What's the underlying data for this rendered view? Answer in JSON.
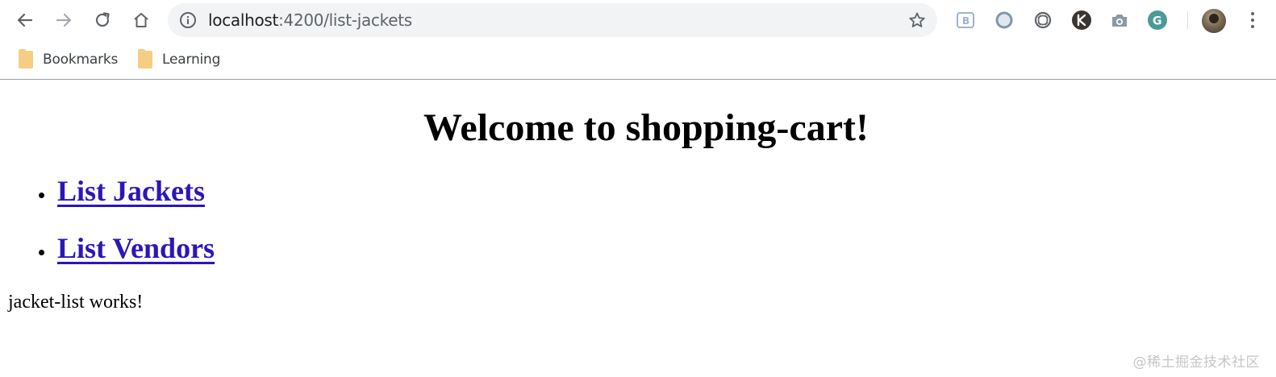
{
  "browser": {
    "url_host": "localhost",
    "url_path": ":4200/list-jackets",
    "extensions": [
      {
        "name": "bootstrap-extension-icon",
        "color": "#8fb6d8"
      },
      {
        "name": "round-extension-icon",
        "color": "#7e99a8"
      },
      {
        "name": "swirl-extension-icon",
        "color": "#5f6368"
      },
      {
        "name": "k-extension-icon",
        "color": "#2f2f2f"
      },
      {
        "name": "camera-extension-icon",
        "color": "#7b8a96"
      },
      {
        "name": "grammarly-extension-icon",
        "color": "#3d8f8b"
      }
    ]
  },
  "bookmarks": [
    {
      "label": "Bookmarks"
    },
    {
      "label": "Learning"
    }
  ],
  "page": {
    "title": "Welcome to shopping-cart!",
    "nav_links": [
      {
        "label": "List Jackets"
      },
      {
        "label": "List Vendors"
      }
    ],
    "status_text": "jacket-list works!",
    "watermark": "@稀土掘金技术社区"
  },
  "colors": {
    "link": "#2b17b8",
    "omnibox_bg": "#f1f3f4",
    "folder": "#f5ce83"
  }
}
